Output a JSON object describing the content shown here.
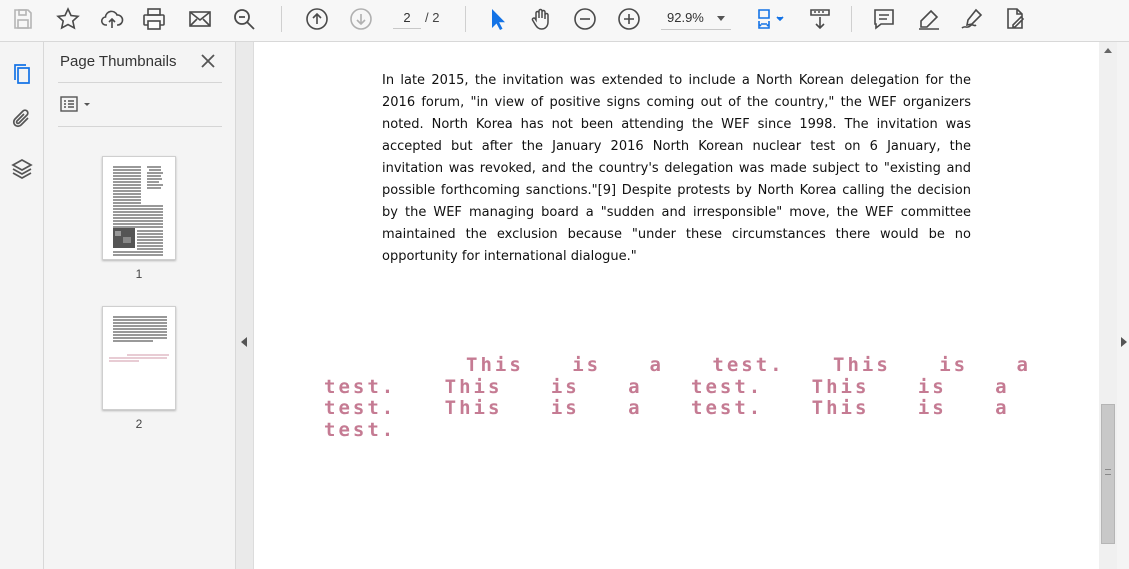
{
  "toolbar": {
    "page_current": "2",
    "page_total": "/ 2",
    "zoom": "92.9%",
    "accent_color": "#1473e6",
    "icons": [
      "save-icon",
      "bookmark-star-icon",
      "upload-cloud-icon",
      "print-icon",
      "email-icon",
      "zoom-search-icon",
      "page-up-icon",
      "page-down-icon",
      "select-cursor-icon",
      "hand-icon",
      "zoom-out-icon",
      "zoom-in-icon",
      "fit-page-icon",
      "scroll-mode-icon",
      "comment-icon",
      "highlight-pen-icon",
      "sign-icon",
      "fill-edit-icon"
    ]
  },
  "left_rail": {
    "icons": [
      "page-thumbnails-icon",
      "attachments-icon",
      "layers-icon"
    ]
  },
  "panel": {
    "title": "Page Thumbnails",
    "thumbnails": [
      {
        "label": "1"
      },
      {
        "label": "2"
      }
    ]
  },
  "document": {
    "paragraph": "In late 2015, the invitation was extended to include a North Korean delegation for the 2016 forum, \"in view of positive signs coming out of the country,\" the WEF organizers noted. North Korea has not been attending the WEF since 1998. The invitation was accepted but after the January 2016 North Korean nuclear test on 6 January, the invitation was revoked, and the country's delegation was made subject to \"existing and possible forthcoming sanctions.\"[9] Despite protests by North Korea calling the decision by the WEF managing board a \"sudden and irresponsible\" move, the WEF committee maintained the exclusion because \"under these circumstances there would be no opportunity for international dialogue.\"",
    "watermark": "This is a test. This is a test. This is a test. This is a test. This is a test. This is a test.",
    "watermark_color": "#c57b93"
  }
}
